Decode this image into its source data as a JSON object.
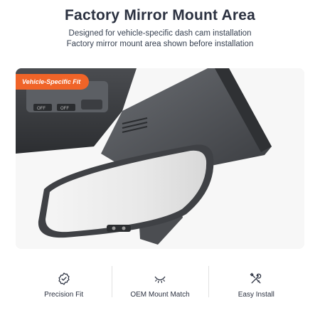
{
  "header": {
    "title": "Factory Mirror Mount Area",
    "subtitle_line1": "Designed for vehicle-specific dash cam installation",
    "subtitle_line2": "Factory mirror mount area shown before installation"
  },
  "photo": {
    "badge": "Vehicle-Specific Fit",
    "badge_color": "#f06428",
    "console_buttons": [
      "OFF",
      "OFF"
    ]
  },
  "features": [
    {
      "icon": "badge-check-icon",
      "label": "Precision Fit"
    },
    {
      "icon": "mount-arc-icon",
      "label": "OEM Mount Match"
    },
    {
      "icon": "tools-icon",
      "label": "Easy Install"
    }
  ]
}
